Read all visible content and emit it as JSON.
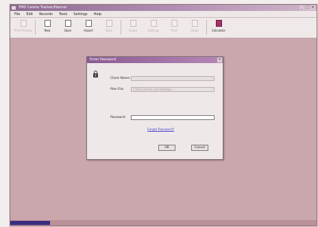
{
  "window": {
    "title": "TMD Calorie Tracker/Planner",
    "controls": [
      "_",
      "□",
      "×"
    ]
  },
  "menu": [
    "File",
    "Edit",
    "Records",
    "Tools",
    "Settings",
    "Help"
  ],
  "toolbar": [
    {
      "label": "Print Preview",
      "enabled": false
    },
    {
      "label": "New",
      "enabled": true
    },
    {
      "label": "Open",
      "enabled": true
    },
    {
      "label": "Import",
      "enabled": true
    },
    {
      "label": "Save",
      "enabled": false
    },
    {
      "label": "Graph",
      "enabled": false
    },
    {
      "label": "Settings",
      "enabled": false
    },
    {
      "label": "Print",
      "enabled": false
    },
    {
      "label": "Setup",
      "enabled": false
    },
    {
      "label": "Calculator",
      "enabled": true
    }
  ],
  "dialog": {
    "title": "Enter Password",
    "close": "×",
    "client_name_label": "Client Name:",
    "client_name_value": "",
    "plan_file_label": "Plan File:",
    "plan_file_value": "C:\\Documents and Settings\\...",
    "password_label": "Password:",
    "password_value": "",
    "forgot_link": "Forgot Password?",
    "ok_label": "OK",
    "cancel_label": "Cancel"
  },
  "statusbar": {
    "progress": 0.13
  },
  "colors": {
    "accent": "#8a5a92",
    "progress": "#3a2b80",
    "workspace": "#caa6ad"
  }
}
